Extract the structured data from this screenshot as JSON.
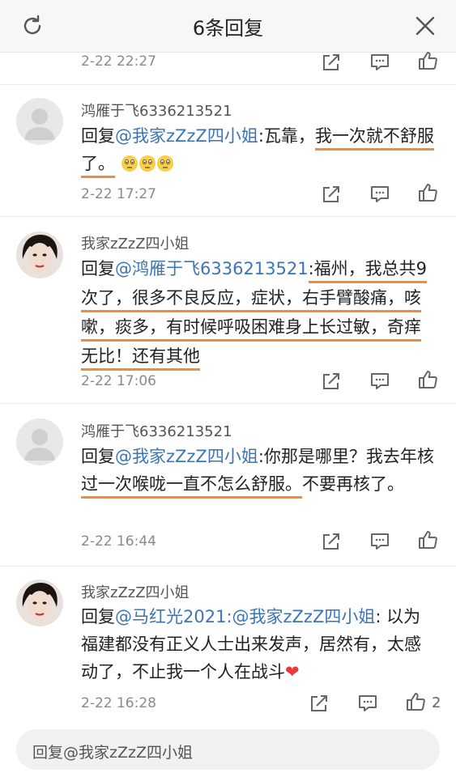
{
  "header": {
    "title": "6条回复"
  },
  "top_meta": {
    "time": "2-22 22:27"
  },
  "comments": [
    {
      "username": "鸿雁于飞6336213521",
      "prefix": "回复",
      "mention": "@我家zZzZ四小姐",
      "text_a": ":瓦靠，",
      "text_hl": "我一次就不舒服了。",
      "emoji": [
        "hmm-emoji",
        "hmm-emoji",
        "hmm-emoji"
      ],
      "time": "2-22 17:27"
    },
    {
      "username": "我家zZzZ四小姐",
      "prefix": "回复",
      "mention": "@鸿雁于飞6336213521",
      "text_hl": ":福州，我总共9次了，很多不良反应，症状，右手臂酸痛，咳嗽，痰多，有时候呼吸困难身上长过敏，奇痒无比！还有其他",
      "time": "2-22 17:06"
    },
    {
      "username": "鸿雁于飞6336213521",
      "prefix": "回复",
      "mention": "@我家zZzZ四小姐",
      "text_a": ":你那是哪里？我去年核",
      "text_hl": "过一次喉咙一直不怎么舒服。",
      "text_b": "不要再核了。",
      "time": "2-22 16:44"
    },
    {
      "username": "我家zZzZ四小姐",
      "prefix": "回复",
      "mention": "@马红光2021",
      "mention2": ":@我家zZzZ四小姐",
      "text_a": ": 以为福建都没有正义人士出来发声，居然有，太感动了，不止我一个人在战斗",
      "heart": "❤",
      "time": "2-22 16:28",
      "likes": "2"
    }
  ],
  "reply_bar": {
    "placeholder": "回复@我家zZzZ四小姐"
  },
  "colors": {
    "mention": "#3d74b6",
    "highlight": "#f08c3b",
    "muted": "#8a8a8a"
  }
}
